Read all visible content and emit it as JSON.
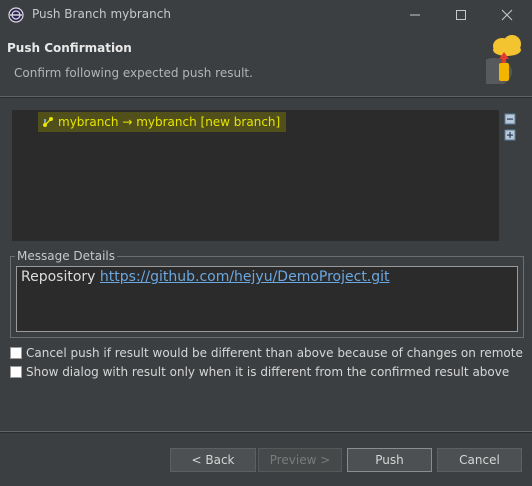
{
  "window": {
    "title": "Push Branch mybranch"
  },
  "header": {
    "title": "Push Confirmation",
    "description": "Confirm following expected push result."
  },
  "tree": {
    "items": [
      {
        "label": "mybranch → mybranch [new branch]",
        "highlight_color": "#52501a",
        "text_color": "#e6e600"
      }
    ]
  },
  "message_details": {
    "label": "Message Details",
    "repository_prefix": "Repository",
    "repository_url": "https://github.com/hejyu/DemoProject.git"
  },
  "options": {
    "cancel_push_label": "Cancel push if result would be different than above because of changes on remote",
    "cancel_push_checked": false,
    "show_dialog_label": "Show dialog with result only when it is different from the confirmed result above",
    "show_dialog_checked": false
  },
  "buttons": {
    "back": "< Back",
    "preview": "Preview >",
    "push": "Push",
    "cancel": "Cancel"
  },
  "icons": {
    "app": "eclipse-icon",
    "header_graphic": "push-to-cloud-icon",
    "tree_item": "branch-push-icon",
    "collapse": "collapse-all-icon",
    "expand": "expand-all-icon"
  },
  "colors": {
    "background": "#3c3f41",
    "panel": "#2b2b2b",
    "link": "#6ba7e0"
  }
}
